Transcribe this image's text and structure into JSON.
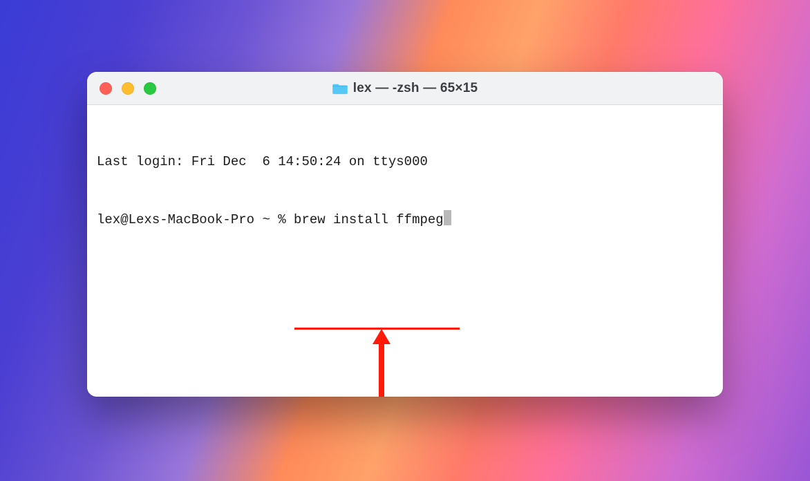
{
  "window": {
    "title": "lex — -zsh — 65×15",
    "traffic_lights": {
      "close": "close",
      "minimize": "minimize",
      "zoom": "zoom"
    },
    "folder_icon_name": "folder-icon"
  },
  "terminal": {
    "last_login_line": "Last login: Fri Dec  6 14:50:24 on ttys000",
    "prompt": "lex@Lexs-MacBook-Pro ~ % ",
    "command": "brew install ffmpeg"
  },
  "annotation": {
    "type": "underline-arrow",
    "target": "command"
  }
}
